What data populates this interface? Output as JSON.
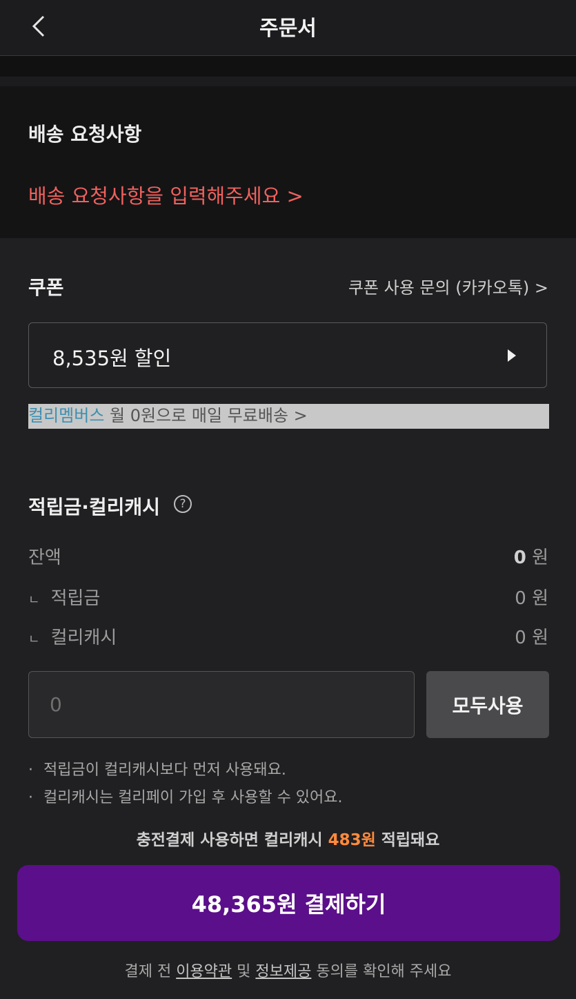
{
  "header": {
    "back_icon": "chevron-left-icon",
    "title": "주문서"
  },
  "delivery": {
    "title": "배송 요청사항",
    "link": "배송 요청사항을 입력해주세요 >"
  },
  "coupon": {
    "title": "쿠폰",
    "help_link": "쿠폰 사용 문의 (카카오톡) >",
    "selected_value": "8,535원 할인",
    "expand_icon": "play-arrow-icon"
  },
  "membership": {
    "brand": "컬리멤버스",
    "text": " 월 0원으로 매일 무료배송 >"
  },
  "points": {
    "title": "적립금·컬리캐시",
    "help_icon": "question-circle-icon",
    "balance_label": "잔액",
    "balance_value": "0",
    "balance_unit": " 원",
    "reward_label": "적립금",
    "reward_value": "0 원",
    "cash_label": "컬리캐시",
    "cash_value": "0 원",
    "sub_marker": "ㄴ",
    "input_placeholder": "0",
    "use_all_label": "모두사용",
    "note_dot": "·",
    "note_1": "적립금이 컬리캐시보다 먼저 사용돼요.",
    "note_2": "컬리캐시는 컬리페이 가입 후 사용할 수 있어요."
  },
  "charge_note": {
    "prefix": "충전결제 사용하면 컬리캐시 ",
    "amount": "483원",
    "suffix": " 적립돼요"
  },
  "payment": {
    "button_label": "48,365원 결제하기",
    "accent_color": "#5b0f8a"
  },
  "agreement": {
    "prefix": "결제 전 ",
    "link_1": "이용약관",
    "middle": " 및 ",
    "link_2": "정보제공",
    "suffix": " 동의를 확인해 주세요"
  }
}
